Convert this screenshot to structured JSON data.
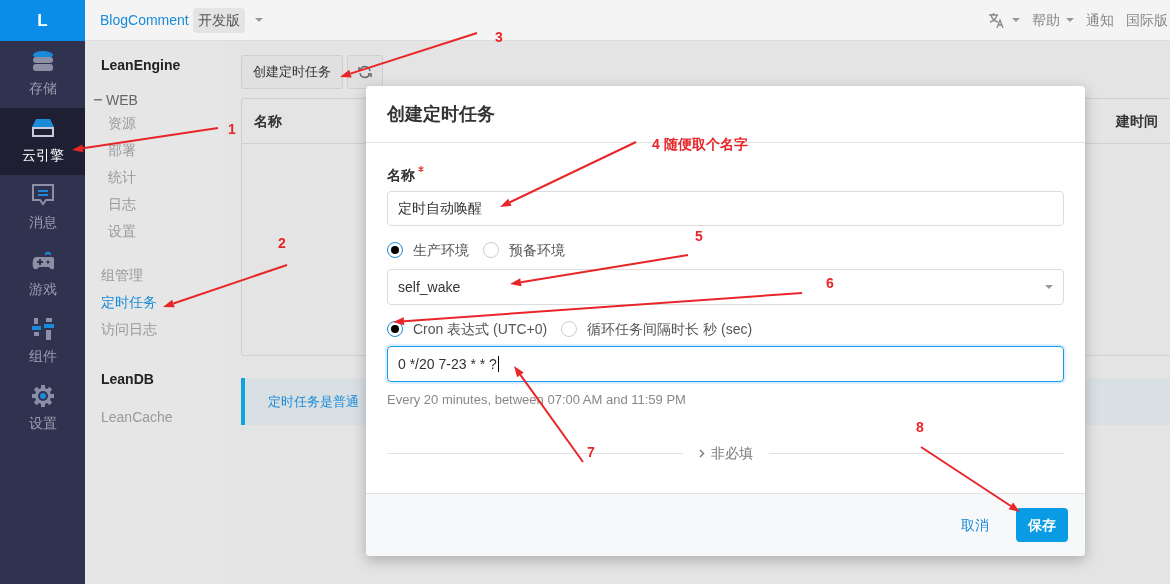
{
  "rail": {
    "logo": "L",
    "items": [
      {
        "label": "存储",
        "kind": "storage",
        "selected": false
      },
      {
        "label": "云引擎",
        "kind": "engine",
        "selected": true
      },
      {
        "label": "消息",
        "kind": "message",
        "selected": false
      },
      {
        "label": "游戏",
        "kind": "game",
        "selected": false
      },
      {
        "label": "组件",
        "kind": "component",
        "selected": false
      },
      {
        "label": "设置",
        "kind": "settings",
        "selected": false
      }
    ]
  },
  "topbar": {
    "app": "BlogComment",
    "edition": "开发版",
    "right": [
      {
        "kind": "translate"
      },
      {
        "kind": "menu",
        "label": "帮助"
      },
      {
        "kind": "link",
        "label": "通知"
      },
      {
        "kind": "link",
        "label": "国际版"
      }
    ]
  },
  "sidebar": {
    "sections": [
      {
        "title": "LeanEngine",
        "items": [
          {
            "label": "WEB",
            "expanded": true,
            "children": [
              {
                "label": "资源",
                "selected": false
              },
              {
                "label": "部署",
                "selected": false
              },
              {
                "label": "统计",
                "selected": false
              },
              {
                "label": "日志",
                "selected": false
              },
              {
                "label": "设置",
                "selected": false
              }
            ]
          },
          {
            "label": "组管理",
            "selected": false
          },
          {
            "label": "定时任务",
            "selected": true
          },
          {
            "label": "访问日志",
            "selected": false
          }
        ]
      },
      {
        "title": "LeanDB",
        "items": [
          {
            "label": "LeanCache",
            "selected": false
          }
        ]
      }
    ]
  },
  "toolbar": {
    "create_button": "创建定时任务"
  },
  "table": {
    "columns": [
      {
        "label": "名称"
      },
      {
        "label": "建时间"
      }
    ]
  },
  "notice": "定时任务是普通",
  "dialog": {
    "title": "创建定时任务",
    "name_field": {
      "label": "名称",
      "required": true,
      "value": "定时自动唤醒"
    },
    "environment": [
      {
        "label": "生产环境",
        "selected": true
      },
      {
        "label": "预备环境",
        "selected": false
      }
    ],
    "function_select": {
      "value": "self_wake"
    },
    "schedule_type": [
      {
        "label": "Cron 表达式 (UTC+0)",
        "selected": true
      },
      {
        "label": "循环任务间隔时长 秒 (sec)",
        "selected": false
      }
    ],
    "cron_field": {
      "value": "0 */20 7-23 * * ?",
      "focused": true
    },
    "cron_hint": "Every 20 minutes, between 07:00 AM and 11:59 PM",
    "optional_toggle": {
      "label": "非必填",
      "expanded": false
    },
    "cancel_button": "取消",
    "save_button": "保存"
  },
  "annotations": [
    {
      "label": "1"
    },
    {
      "label": "2"
    },
    {
      "label": "3"
    },
    {
      "label": "4 随便取个名字"
    },
    {
      "label": "5"
    },
    {
      "label": "6"
    },
    {
      "label": "7"
    },
    {
      "label": "8"
    }
  ]
}
